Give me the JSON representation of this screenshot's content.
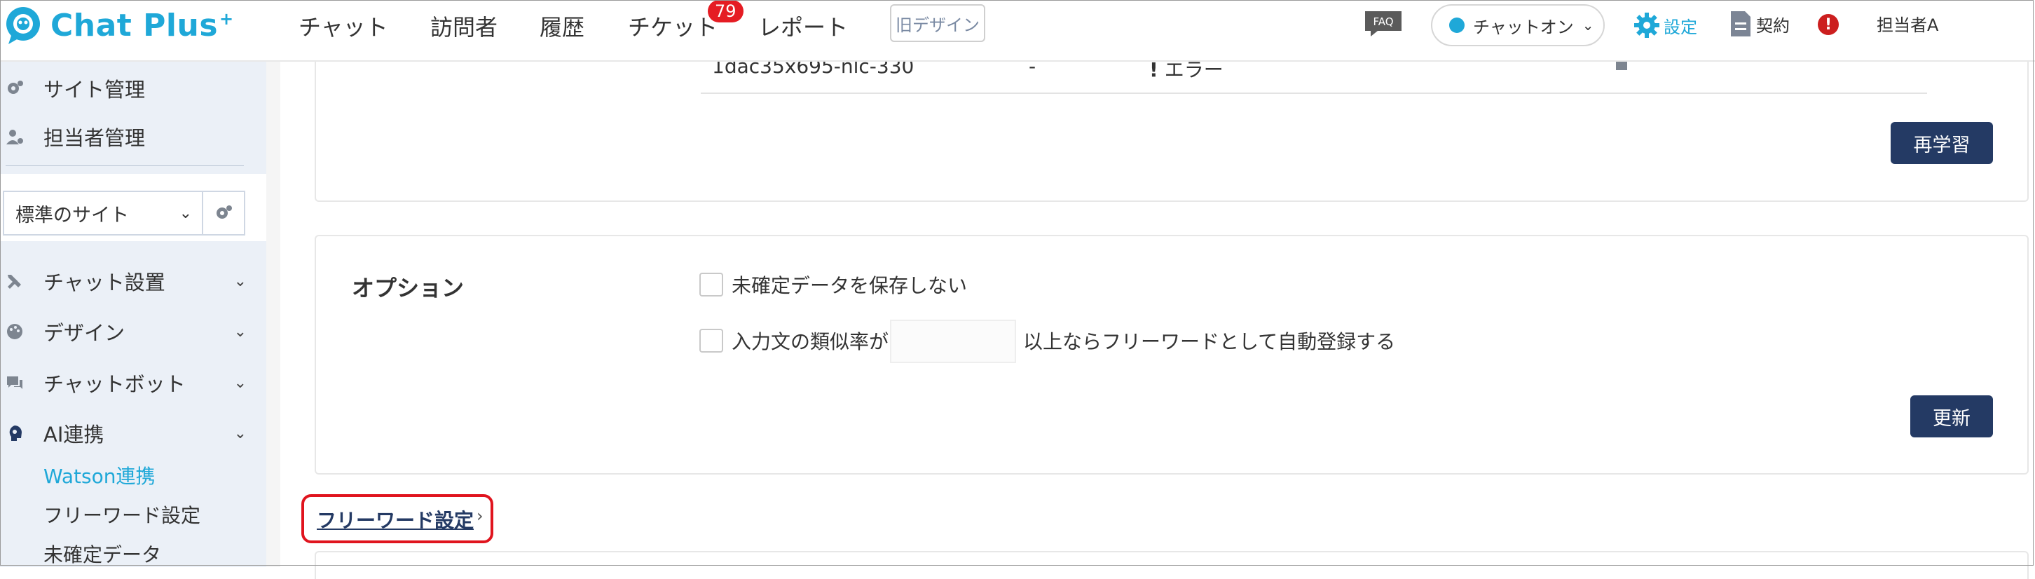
{
  "header": {
    "logo_text": "Chat Plus",
    "logo_sup": "+",
    "nav": [
      "チャット",
      "訪問者",
      "履歴",
      "チケット",
      "レポート"
    ],
    "ticket_badge": "79",
    "old_design": "旧デザイン",
    "faq": "FAQ",
    "chat_status": "チャットオン",
    "settings": "設定",
    "contract": "契約",
    "alert": "!",
    "user": "担当者A"
  },
  "sidebar": {
    "site_manage": "サイト管理",
    "staff_manage": "担当者管理",
    "site_select": "標準のサイト",
    "items": [
      "チャット設置",
      "デザイン",
      "チャットボット",
      "AI連携"
    ],
    "sub_items": [
      "Watson連携",
      "フリーワード設定",
      "未確定データ"
    ]
  },
  "main": {
    "table_row": {
      "id": "1dac35x695-nlc-330",
      "dash": "-",
      "status": "エラー"
    },
    "relearn_button": "再学習",
    "options": {
      "title": "オプション",
      "opt1": "未確定データを保存しない",
      "opt2_before": "入力文の類似率が",
      "opt2_after": "以上ならフリーワードとして自動登録する",
      "update_button": "更新"
    },
    "freeword_link": "フリーワード設定",
    "freeword_arrow": "›"
  },
  "colors": {
    "brand": "#1fa8d8",
    "navy": "#243a64",
    "badge": "#e51c23",
    "highlight": "#e0141e"
  }
}
